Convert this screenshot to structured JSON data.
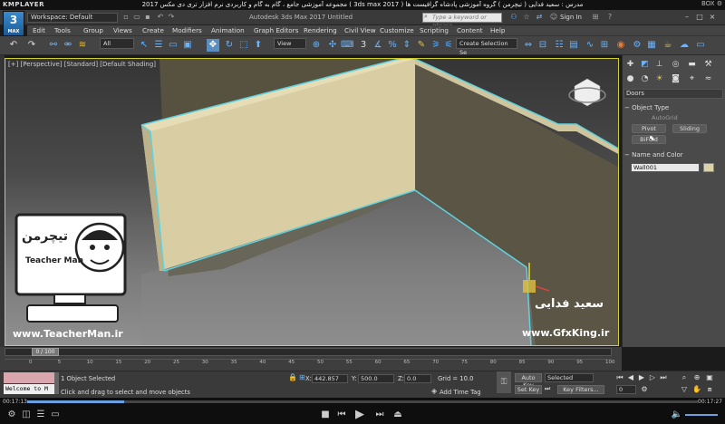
{
  "player": {
    "logo": "KMPLAYER",
    "title": "مجموعه آموزشی جامع ، گام به گام و کاربردی نرم افزار تری دی مکس 2017 ( 3ds max 2017 )   مدرس : سعید فدایی ( تیچرمن ) گروه آموزشی پادشاه گرافیست ها",
    "right_label": "BOX ⚙",
    "time_elapsed": "00:17:13",
    "time_total": "00:17:27",
    "progress": 0.145
  },
  "max": {
    "logo": "3",
    "logo_sub": "MAX",
    "workspace": "Workspace: Default",
    "app_title": "Autodesk 3ds Max 2017   Untitled",
    "search_placeholder": "Type a keyword or phrase",
    "sign_in": "Sign In"
  },
  "menu": [
    "Edit",
    "Tools",
    "Group",
    "Views",
    "Create",
    "Modifiers",
    "Animation",
    "Graph Editors",
    "Rendering",
    "Civil View",
    "Customize",
    "Scripting",
    "Content",
    "Help"
  ],
  "toolbar": {
    "filter": "All",
    "ref_coord": "View",
    "selection_set": "Create Selection Se"
  },
  "viewport": {
    "label": "[+] [Perspective] [Standard] [Default Shading]"
  },
  "command_panel": {
    "category": "Doors",
    "object_type_title": "Object Type",
    "autogrid": "AutoGrid",
    "pivot": "Pivot",
    "sliding": "Sliding",
    "bifold": "BiFold",
    "name_color_title": "Name and Color",
    "object_name": "Wall001",
    "object_color": "#dcd2a7"
  },
  "timeline": {
    "frame": "0 / 100",
    "ticks": [
      "0",
      "5",
      "10",
      "15",
      "20",
      "25",
      "30",
      "35",
      "40",
      "45",
      "50",
      "55",
      "60",
      "65",
      "70",
      "75",
      "80",
      "85",
      "90",
      "95",
      "100"
    ]
  },
  "status": {
    "welcome": "Welcome to M",
    "selected": "1 Object Selected",
    "hint": "Click and drag to select and move objects",
    "x_label": "X:",
    "x_value": "442.857",
    "y_label": "Y:",
    "y_value": "500.0",
    "z_label": "Z:",
    "z_value": "0.0",
    "grid": "Grid = 10.0",
    "add_time_tag": "Add Time Tag",
    "auto_key": "Auto Key",
    "selected_dropdown": "Selected",
    "set_key": "Set Key",
    "key_filters": "Key Filters...",
    "frame_field": "0"
  },
  "overlay": {
    "site_left": "www.TeacherMan.ir",
    "site_right": "www.GfxKing.ir",
    "teacher_name": "Teacher Man",
    "teacher_logo": "تیچرمن",
    "author_fa": "سعید فدایی"
  },
  "colors": {
    "wall_front": "#d8cda3",
    "wall_back": "#5a5446",
    "selection_outline": "#5fd3e0",
    "accent": "#3a8bd0"
  }
}
